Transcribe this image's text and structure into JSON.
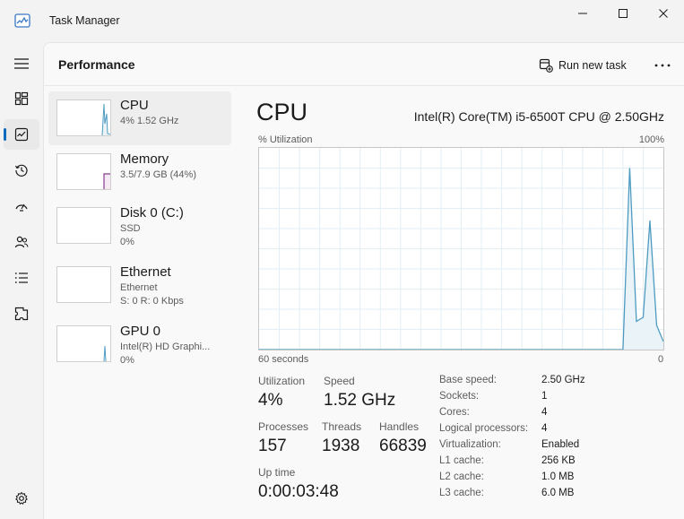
{
  "window": {
    "title": "Task Manager"
  },
  "nav": {
    "items": [
      {
        "name": "hamburger-menu-icon"
      },
      {
        "name": "processes-icon"
      },
      {
        "name": "performance-icon",
        "active": true
      },
      {
        "name": "app-history-icon"
      },
      {
        "name": "startup-apps-icon"
      },
      {
        "name": "users-icon"
      },
      {
        "name": "details-icon"
      },
      {
        "name": "services-icon"
      },
      {
        "name": "settings-icon"
      }
    ]
  },
  "header": {
    "title": "Performance",
    "run_new_task": "Run new task",
    "more_label": "···"
  },
  "devices": [
    {
      "name": "CPU",
      "line1": "4%  1.52 GHz",
      "line2": ""
    },
    {
      "name": "Memory",
      "line1": "3.5/7.9 GB (44%)",
      "line2": ""
    },
    {
      "name": "Disk 0 (C:)",
      "line1": "SSD",
      "line2": "0%"
    },
    {
      "name": "Ethernet",
      "line1": "Ethernet",
      "line2": "S: 0  R: 0 Kbps"
    },
    {
      "name": "GPU 0",
      "line1": "Intel(R) HD Graphi...",
      "line2": "0%"
    }
  ],
  "detail": {
    "title": "CPU",
    "model": "Intel(R) Core(TM) i5-6500T CPU @ 2.50GHz",
    "graph_label_left": "% Utilization",
    "graph_label_right": "100%",
    "axis_left": "60 seconds",
    "axis_right": "0"
  },
  "stats": {
    "utilization_label": "Utilization",
    "utilization_value": "4%",
    "speed_label": "Speed",
    "speed_value": "1.52 GHz",
    "processes_label": "Processes",
    "processes_value": "157",
    "threads_label": "Threads",
    "threads_value": "1938",
    "handles_label": "Handles",
    "handles_value": "66839",
    "uptime_label": "Up time",
    "uptime_value": "0:00:03:48"
  },
  "specs": [
    {
      "key": "Base speed:",
      "value": "2.50 GHz"
    },
    {
      "key": "Sockets:",
      "value": "1"
    },
    {
      "key": "Cores:",
      "value": "4"
    },
    {
      "key": "Logical processors:",
      "value": "4"
    },
    {
      "key": "Virtualization:",
      "value": "Enabled"
    },
    {
      "key": "L1 cache:",
      "value": "256 KB"
    },
    {
      "key": "L2 cache:",
      "value": "1.0 MB"
    },
    {
      "key": "L3 cache:",
      "value": "6.0 MB"
    }
  ],
  "colors": {
    "cpu_line": "#4d9bc1",
    "cpu_fill": "#eaf3f8",
    "memory_line": "#8b3a8f",
    "accent": "#0f6cbd"
  },
  "chart_data": {
    "type": "area",
    "x": [
      60,
      59,
      58,
      57,
      56,
      55,
      54,
      53,
      52,
      51,
      50,
      49,
      48,
      47,
      46,
      45,
      44,
      43,
      42,
      41,
      40,
      39,
      38,
      37,
      36,
      35,
      34,
      33,
      32,
      31,
      30,
      29,
      28,
      27,
      26,
      25,
      24,
      23,
      22,
      21,
      20,
      19,
      18,
      17,
      16,
      15,
      14,
      13,
      12,
      11,
      10,
      9,
      8,
      7,
      6,
      5,
      4,
      3,
      2,
      1,
      0
    ],
    "series": [
      {
        "values": [
          0,
          0,
          0,
          0,
          0,
          0,
          0,
          0,
          0,
          0,
          0,
          0,
          0,
          0,
          0,
          0,
          0,
          0,
          0,
          0,
          0,
          0,
          0,
          0,
          0,
          0,
          0,
          0,
          0,
          0,
          0,
          0,
          0,
          0,
          0,
          0,
          0,
          0,
          0,
          0,
          0,
          0,
          0,
          0,
          0,
          0,
          0,
          0,
          0,
          0,
          0,
          0,
          0,
          0,
          0,
          90,
          14,
          16,
          64,
          12,
          4
        ]
      }
    ],
    "ylim": [
      0,
      100
    ],
    "xlim": [
      60,
      0
    ],
    "grid": true
  }
}
